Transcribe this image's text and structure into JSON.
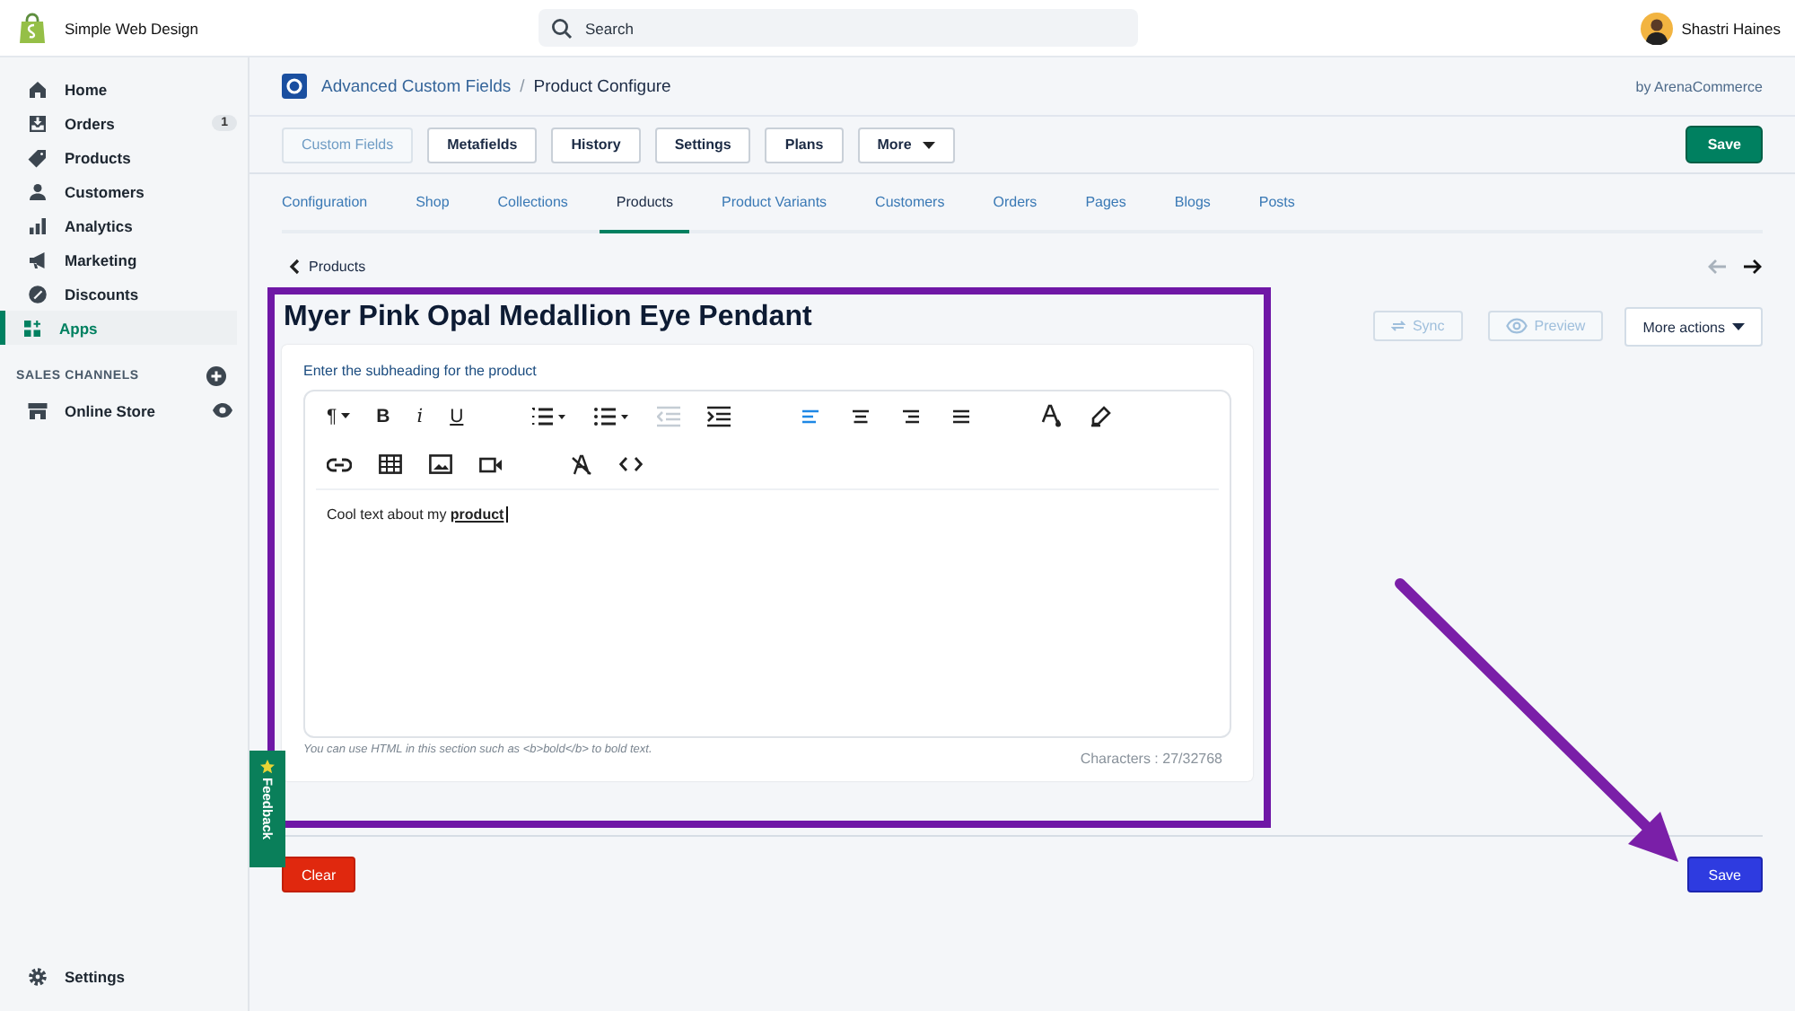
{
  "top_bar": {
    "store_name": "Simple Web Design",
    "search": {
      "placeholder": "Search"
    },
    "user_name": "Shastri Haines"
  },
  "sidebar": {
    "items": [
      {
        "label": "Home",
        "selected": false
      },
      {
        "label": "Orders",
        "selected": false,
        "badge": "1"
      },
      {
        "label": "Products",
        "selected": false
      },
      {
        "label": "Customers",
        "selected": false
      },
      {
        "label": "Analytics",
        "selected": false
      },
      {
        "label": "Marketing",
        "selected": false
      },
      {
        "label": "Discounts",
        "selected": false
      },
      {
        "label": "Apps",
        "selected": true
      }
    ],
    "sales_channels": {
      "heading": "SALES CHANNELS",
      "items": [
        {
          "label": "Online Store"
        }
      ]
    },
    "settings": "Settings"
  },
  "app_header": {
    "app_name": "Advanced Custom Fields",
    "separator": "/",
    "page": "Product Configure",
    "vendor": "by ArenaCommerce"
  },
  "action_buttons": [
    {
      "label": "Custom Fields",
      "selected": true,
      "kind": "button"
    },
    {
      "label": "Metafields",
      "selected": false,
      "kind": "button"
    },
    {
      "label": "History",
      "selected": false,
      "kind": "button"
    },
    {
      "label": "Settings",
      "selected": false,
      "kind": "button"
    },
    {
      "label": "Plans",
      "selected": false,
      "kind": "button"
    },
    {
      "label": "More",
      "selected": false,
      "kind": "dropdown"
    }
  ],
  "save_top": "Save",
  "tabs": [
    {
      "label": "Configuration",
      "selected": false
    },
    {
      "label": "Shop",
      "selected": false
    },
    {
      "label": "Collections",
      "selected": false
    },
    {
      "label": "Products",
      "selected": true
    },
    {
      "label": "Product Variants",
      "selected": false
    },
    {
      "label": "Customers",
      "selected": false
    },
    {
      "label": "Orders",
      "selected": false
    },
    {
      "label": "Pages",
      "selected": false
    },
    {
      "label": "Blogs",
      "selected": false
    },
    {
      "label": "Posts",
      "selected": false
    }
  ],
  "back_link": "Products",
  "pager": {
    "previous_disabled": true,
    "next_disabled": false
  },
  "product_title": "Myer Pink Opal Medallion Eye Pendant",
  "product_actions": [
    {
      "label": "Sync",
      "disabled": true,
      "kind": "sync"
    },
    {
      "label": "Preview",
      "disabled": true,
      "kind": "preview"
    },
    {
      "label": "More actions",
      "disabled": false,
      "kind": "dropdown"
    }
  ],
  "editor": {
    "label": "Enter the subheading for the product",
    "format_glyphs": [
      "¶",
      "B",
      "i",
      "U"
    ],
    "outdent_disabled": true,
    "alignment": [
      {
        "selected": true
      },
      {
        "selected": false
      },
      {
        "selected": false
      },
      {
        "selected": false
      }
    ],
    "content": "Cool text about my **product**",
    "hint": "You can use HTML in this section such as <b>bold</b> to bold text.",
    "counter": "Characters : 27/32768"
  },
  "footer": {
    "clear": "Clear",
    "save": "Save"
  },
  "feedback_tab": "Feedback"
}
